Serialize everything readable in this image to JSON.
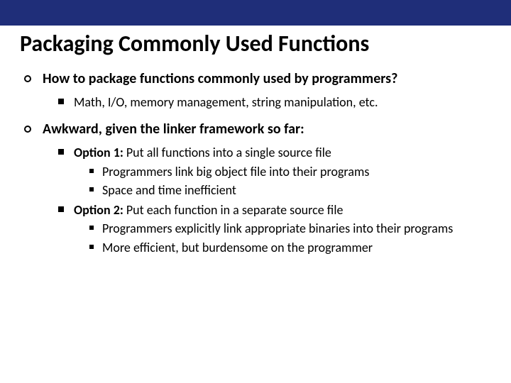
{
  "title": "Packaging Commonly Used Functions",
  "bullets": {
    "b1": {
      "head": "How to package functions commonly used by programmers?",
      "sub1": "Math, I/O, memory management, string manipulation, etc."
    },
    "b2": {
      "head": "Awkward, given the linker framework so far:",
      "opt1": {
        "label": "Option 1:",
        "text": " Put all functions into a single source file",
        "s1": "Programmers link big object file into their programs",
        "s2": "Space and time inefficient"
      },
      "opt2": {
        "label": "Option 2:",
        "text": " Put each function in a separate source file",
        "s1": "Programmers explicitly link appropriate binaries into their programs",
        "s2": "More efficient, but burdensome on the programmer"
      }
    }
  }
}
